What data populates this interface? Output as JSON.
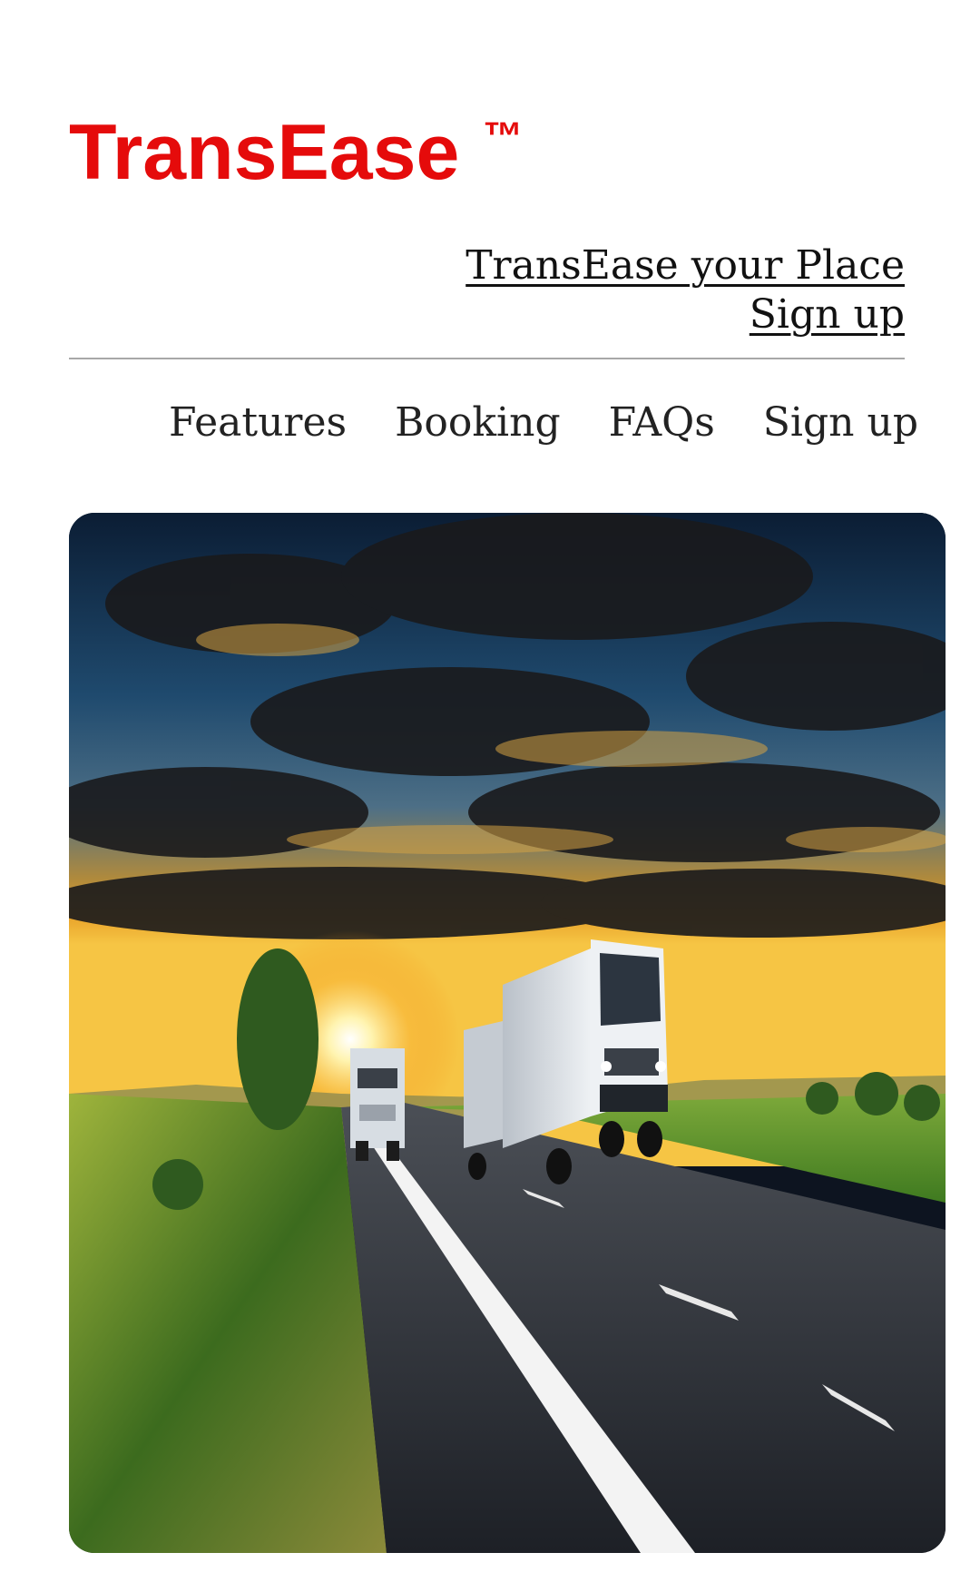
{
  "header": {
    "brand": "TransEase",
    "trademark": "™"
  },
  "top_links": {
    "tagline": "TransEase your Place",
    "signup": "Sign up"
  },
  "nav": {
    "items": [
      "Features",
      "Booking",
      "FAQs",
      "Sign up"
    ]
  },
  "hero": {
    "image": "trucks-on-highway-at-sunset"
  }
}
